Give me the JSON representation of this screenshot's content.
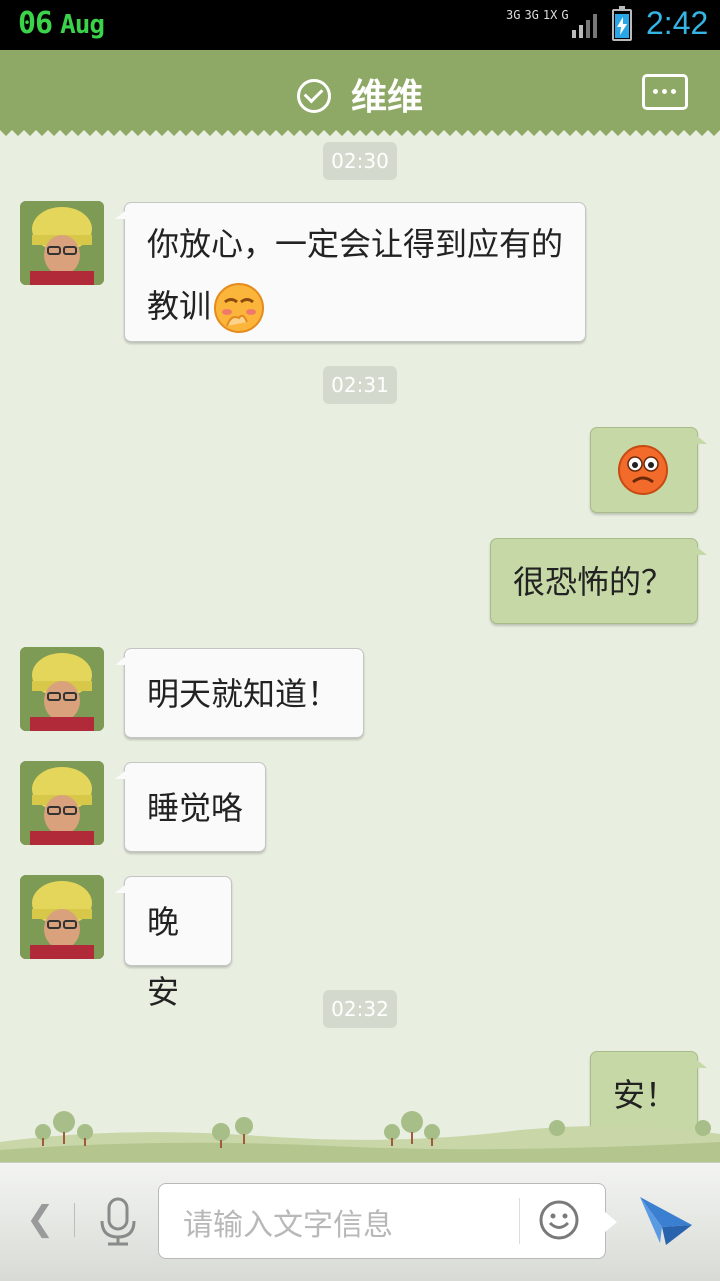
{
  "status_bar": {
    "day": "06",
    "month": "Aug",
    "network_1": "3G",
    "network_2": "3G",
    "network_3": "1X",
    "network_4": "G",
    "time": "2:42"
  },
  "header": {
    "title": "维维",
    "status_icon": "check-circle-icon",
    "menu_icon": "more-dots-icon"
  },
  "messages": [
    {
      "type": "timestamp",
      "text": "02:30"
    },
    {
      "type": "incoming",
      "text": "你放心，一定会让得到应有的教训",
      "emoji": "smirk-emoji"
    },
    {
      "type": "timestamp",
      "text": "02:31"
    },
    {
      "type": "outgoing",
      "emoji": "scared-face-emoji"
    },
    {
      "type": "outgoing",
      "text": "很恐怖的？"
    },
    {
      "type": "incoming",
      "text": "明天就知道！"
    },
    {
      "type": "incoming",
      "text": "睡觉咯"
    },
    {
      "type": "incoming",
      "text": "晚安"
    },
    {
      "type": "timestamp",
      "text": "02:32"
    },
    {
      "type": "outgoing",
      "text": "安！"
    }
  ],
  "input_bar": {
    "placeholder": "请输入文字信息",
    "back_icon": "chevron-left-icon",
    "mic_icon": "microphone-icon",
    "emoji_icon": "smiley-icon",
    "send_icon": "paper-plane-icon"
  },
  "colors": {
    "header": "#8ea865",
    "chat_background": "#e8eee0",
    "outgoing_bubble": "#c5d8a6",
    "incoming_bubble": "#fafafa",
    "time_accent": "#35b5e5",
    "date_accent": "#3bd34a"
  }
}
